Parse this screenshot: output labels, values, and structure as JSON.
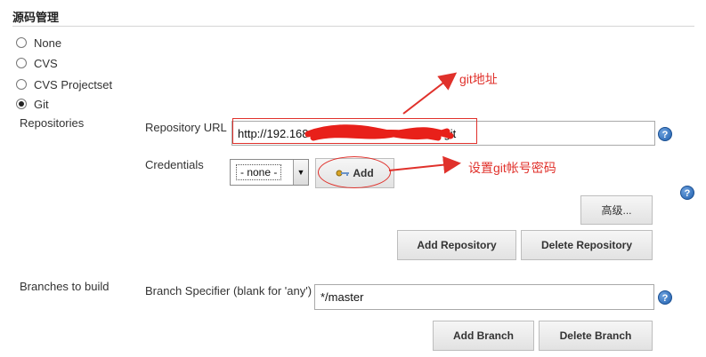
{
  "section": {
    "title": "源码管理"
  },
  "scm_options": [
    {
      "label": "None",
      "checked": false
    },
    {
      "label": "CVS",
      "checked": false
    },
    {
      "label": "CVS Projectset",
      "checked": false
    },
    {
      "label": "Git",
      "checked": true
    }
  ],
  "repositories": {
    "label": "Repositories",
    "url_label": "Repository URL",
    "url_prefix": "http://192.168",
    "url_suffix": "git",
    "credentials_label": "Credentials",
    "credentials_value": "- none -",
    "add_label": "Add",
    "advanced_label": "高级...",
    "add_repository_label": "Add Repository",
    "delete_repository_label": "Delete Repository"
  },
  "branches": {
    "label": "Branches to build",
    "specifier_label": "Branch Specifier (blank for 'any')",
    "specifier_value": "*/master",
    "add_branch_label": "Add Branch",
    "delete_branch_label": "Delete Branch"
  },
  "annotations": {
    "git_address": "git地址",
    "set_credentials": "设置git帐号密码"
  },
  "help_glyph": "?",
  "colors": {
    "annotation_red": "#e0312b",
    "help_blue": "#1f5fae"
  }
}
